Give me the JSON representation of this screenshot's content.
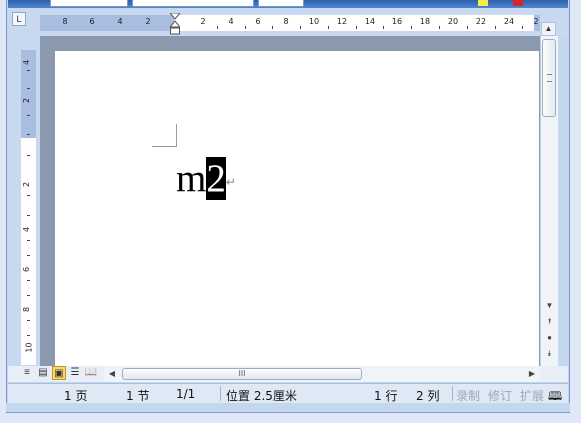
{
  "ruler": {
    "tab_selector": "L",
    "numbers_left": [
      "8",
      "6",
      "4",
      "2"
    ],
    "numbers_right": [
      "2",
      "4",
      "6",
      "8",
      "10",
      "12",
      "14",
      "16",
      "18",
      "20",
      "22",
      "24",
      "2"
    ]
  },
  "vruler": {
    "numbers": [
      "4",
      "2",
      "2",
      "4",
      "6",
      "8",
      "10"
    ]
  },
  "document": {
    "text_before_selection": "m",
    "selected_text": "2",
    "paragraph_mark": "↵"
  },
  "hscroll": {
    "thumb_label": "III"
  },
  "statusbar": {
    "page": "1 页",
    "section": "1 节",
    "page_count": "1/1",
    "position": "位置 2.5厘米",
    "line": "1 行",
    "column": "2 列",
    "record": "录制",
    "revise": "修订",
    "extend": "扩展"
  },
  "colors": {
    "selection": "#000000",
    "page": "#ffffff",
    "ruler_margin": "#a9bde0",
    "toolbar_yellow": "#f3f04a",
    "toolbar_red": "#d9232a"
  }
}
